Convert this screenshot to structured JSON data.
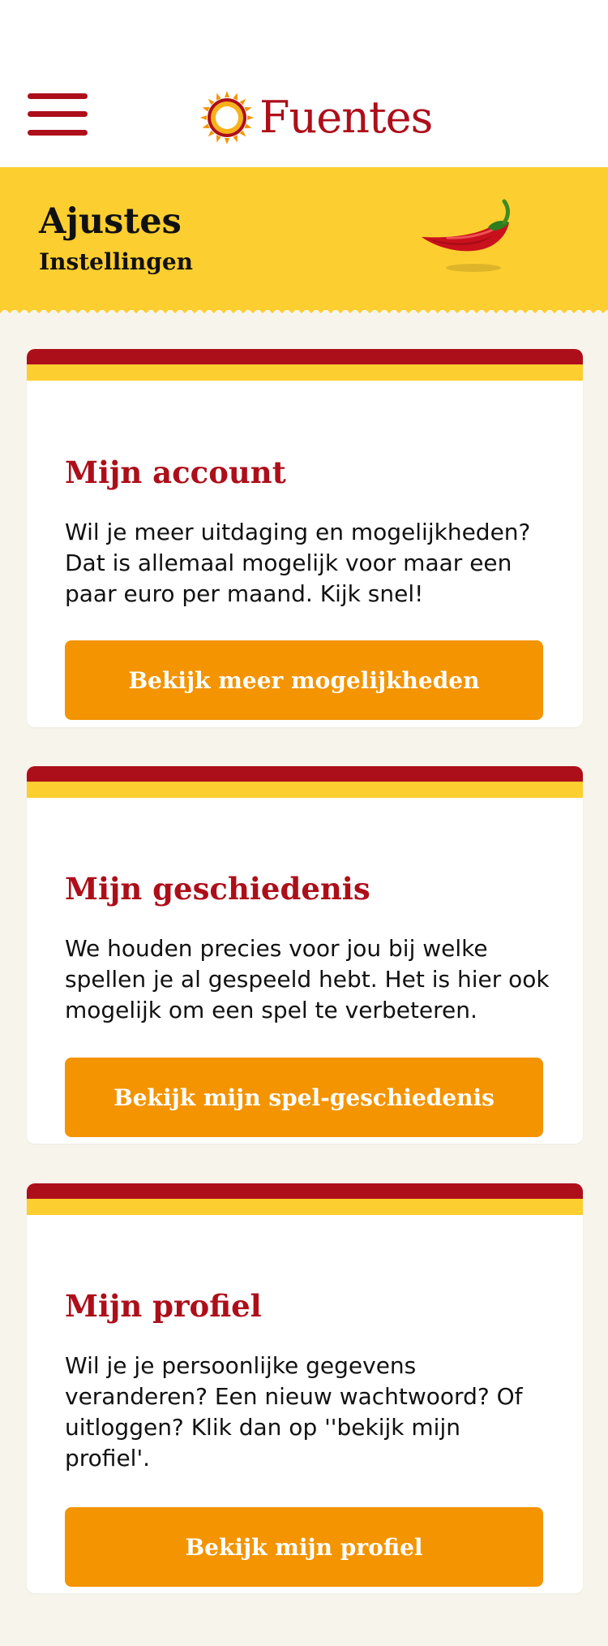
{
  "header": {
    "logo_text": "Fuentes",
    "logo_icon": "sun-icon",
    "menu_icon": "hamburger-menu-icon"
  },
  "banner": {
    "title": "Ajustes",
    "subtitle": "Instellingen",
    "decoration_icon": "chili-pepper-icon"
  },
  "cards": [
    {
      "title": "Mijn account",
      "text": "Wil je meer uitdaging en mogelijkheden? Dat is allemaal mogelijk voor maar een paar euro per maand. Kijk snel!",
      "button_label": "Bekijk meer mogelijkheden"
    },
    {
      "title": "Mijn geschiedenis",
      "text": "We houden precies voor jou bij welke spellen je al gespeeld hebt. Het is hier ook mogelijk om een spel te verbeteren.",
      "button_label": "Bekijk mijn spel-geschiedenis"
    },
    {
      "title": "Mijn profiel",
      "text": "Wil je je persoonlijke gegevens veranderen? Een nieuw wachtwoord? Of uitloggen? Klik dan op ''bekijk mijn profiel'.",
      "button_label": "Bekijk mijn profiel"
    }
  ],
  "colors": {
    "brand_red": "#ad0f1a",
    "brand_yellow": "#fdce30",
    "button_orange": "#f39400",
    "page_background": "#f7f4ec"
  }
}
